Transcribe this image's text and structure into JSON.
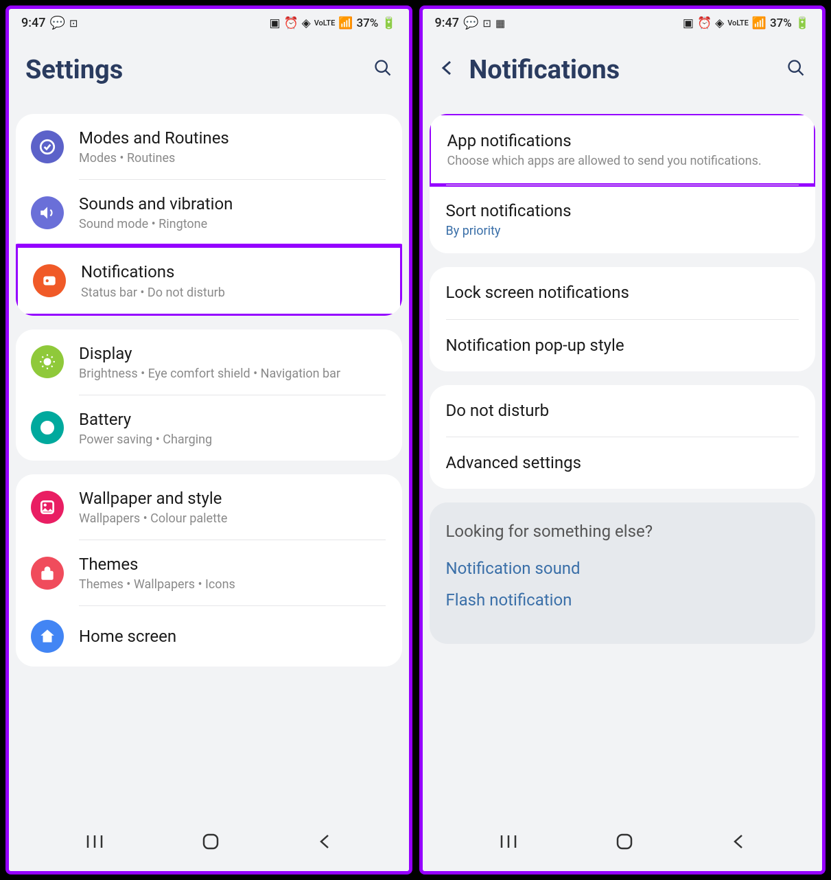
{
  "status": {
    "time": "9:47",
    "battery": "37%"
  },
  "left": {
    "title": "Settings",
    "groups": [
      {
        "items": [
          {
            "icon": "routines",
            "bg": "bg-purple-dark",
            "title": "Modes and Routines",
            "sub": "Modes  •  Routines",
            "hl": false
          },
          {
            "icon": "sound",
            "bg": "bg-purple",
            "title": "Sounds and vibration",
            "sub": "Sound mode  •  Ringtone",
            "hl": false
          },
          {
            "icon": "notif",
            "bg": "bg-orange",
            "title": "Notifications",
            "sub": "Status bar  •  Do not disturb",
            "hl": true
          }
        ]
      },
      {
        "items": [
          {
            "icon": "display",
            "bg": "bg-green",
            "title": "Display",
            "sub": "Brightness  •  Eye comfort shield  •  Navigation bar",
            "hl": false
          },
          {
            "icon": "battery",
            "bg": "bg-teal",
            "title": "Battery",
            "sub": "Power saving  •  Charging",
            "hl": false
          }
        ]
      },
      {
        "items": [
          {
            "icon": "wallpaper",
            "bg": "bg-pink",
            "title": "Wallpaper and style",
            "sub": "Wallpapers  •  Colour palette",
            "hl": false
          },
          {
            "icon": "themes",
            "bg": "bg-red",
            "title": "Themes",
            "sub": "Themes  •  Wallpapers  •  Icons",
            "hl": false
          },
          {
            "icon": "home",
            "bg": "bg-blue",
            "title": "Home screen",
            "sub": "",
            "hl": false
          }
        ]
      }
    ]
  },
  "right": {
    "title": "Notifications",
    "groups": [
      {
        "items": [
          {
            "title": "App notifications",
            "sub": "Choose which apps are allowed to send you notifications.",
            "hl": true
          },
          {
            "title": "Sort notifications",
            "sub": "By priority",
            "blue": true,
            "hl": false
          }
        ]
      },
      {
        "items": [
          {
            "title": "Lock screen notifications",
            "sub": "",
            "hl": false
          },
          {
            "title": "Notification pop-up style",
            "sub": "",
            "hl": false
          }
        ]
      },
      {
        "items": [
          {
            "title": "Do not disturb",
            "sub": "",
            "hl": false
          },
          {
            "title": "Advanced settings",
            "sub": "",
            "hl": false
          }
        ]
      }
    ],
    "footer": {
      "title": "Looking for something else?",
      "links": [
        "Notification sound",
        "Flash notification"
      ]
    }
  }
}
